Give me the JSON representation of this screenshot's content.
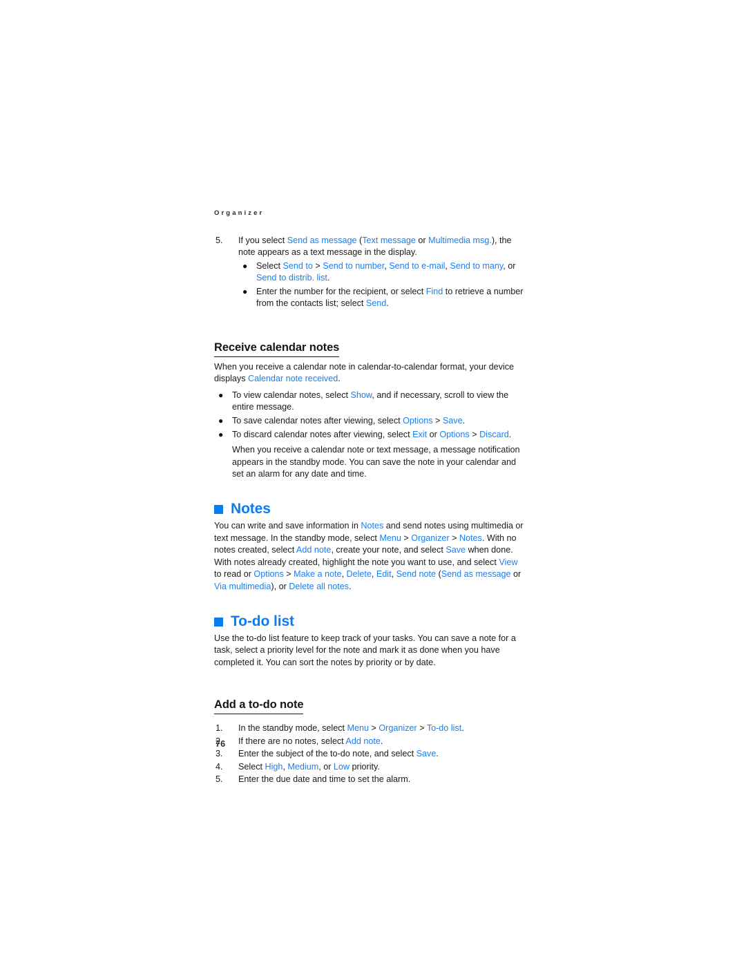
{
  "page": {
    "running_header": "Organizer",
    "folio": "76",
    "accent_color": "#0a7cf0",
    "link_color": "#1a7ff0",
    "text_color": "#1a1a1a"
  },
  "step5": {
    "number": "5.",
    "text_1": "If you select ",
    "link_send_as_message": "Send as message",
    "text_2": " (",
    "link_text_message": "Text message",
    "text_3": " or ",
    "link_multimedia_msg": "Multimedia msg.",
    "text_4": "), the note appears as a text message in the display.",
    "bullets": {
      "b1": {
        "t1": "Select ",
        "l1": "Send to",
        "t2": " > ",
        "l2": "Send to number",
        "t3": ", ",
        "l3": "Send to e-mail",
        "t4": ", ",
        "l4": "Send to many",
        "t5": ", or ",
        "l5": "Send to distrib. list",
        "t6": "."
      },
      "b2": {
        "t1": "Enter the number for the recipient, or select ",
        "l1": "Find",
        "t2": " to retrieve a number from the contacts list; select ",
        "l2": "Send",
        "t3": "."
      }
    }
  },
  "receive_calendar_notes": {
    "heading": "Receive calendar notes",
    "intro": {
      "t1": "When you receive a calendar note in calendar-to-calendar format, your device displays ",
      "l1": "Calendar note received",
      "t2": "."
    },
    "bullets": [
      {
        "t1": "To view calendar notes, select ",
        "l1": "Show",
        "t2": ", and if necessary, scroll to view the entire message."
      },
      {
        "t1": "To save calendar notes after viewing, select ",
        "l1": "Options",
        "t2": " > ",
        "l2": "Save",
        "t3": "."
      },
      {
        "t1": "To discard calendar notes after viewing, select ",
        "l1": "Exit",
        "t2": " or ",
        "l2": "Options",
        "t3": " > ",
        "l3": "Discard",
        "t4": "."
      }
    ],
    "closing_paragraph": "When you receive a calendar note or text message, a message notification appears in the standby mode. You can save the note in your calendar and set an alarm for any date and time."
  },
  "notes_section": {
    "heading": "Notes",
    "body": {
      "t1": "You can write and save information in ",
      "l1": "Notes",
      "t2": " and send notes using multimedia or text message. In the standby mode, select ",
      "l2": "Menu",
      "t3": " > ",
      "l3": "Organizer",
      "t4": " > ",
      "l4": "Notes",
      "t5": ". With no notes created, select ",
      "l5": "Add note",
      "t6": ", create your note, and select ",
      "l6": "Save",
      "t7": " when done. With notes already created, highlight the note you want to use, and select ",
      "l7": "View",
      "t8": " to read or ",
      "l8": "Options",
      "t9": " > ",
      "l9": "Make a note",
      "t10": ", ",
      "l10": "Delete",
      "t11": ", ",
      "l11": "Edit",
      "t12": ", ",
      "l12": "Send note",
      "t13": " (",
      "l13": "Send as message",
      "t14": " or ",
      "l14": "Via multimedia",
      "t15": "), or ",
      "l15": "Delete all notes",
      "t16": "."
    }
  },
  "todo_section": {
    "heading": "To-do list",
    "body": "Use the to-do list feature to keep track of your tasks. You can save a note for a task, select a priority level for the note and mark it as done when you have completed it. You can sort the notes by priority or by date.",
    "add_note_heading": "Add a to-do note",
    "steps": [
      {
        "num": "1.",
        "t1": "In the standby mode, select ",
        "l1": "Menu",
        "t2": " > ",
        "l2": "Organizer",
        "t3": " > ",
        "l3": "To-do list",
        "t4": "."
      },
      {
        "num": "2.",
        "t1": "If there are no notes, select ",
        "l1": "Add note",
        "t2": "."
      },
      {
        "num": "3.",
        "t1": "Enter the subject of the to-do note, and select ",
        "l1": "Save",
        "t2": "."
      },
      {
        "num": "4.",
        "t1": "Select ",
        "l1": "High",
        "t2": ", ",
        "l2": "Medium",
        "t3": ", or ",
        "l3": "Low",
        "t4": " priority."
      },
      {
        "num": "5.",
        "t1": "Enter the due date and time to set the alarm."
      }
    ]
  }
}
